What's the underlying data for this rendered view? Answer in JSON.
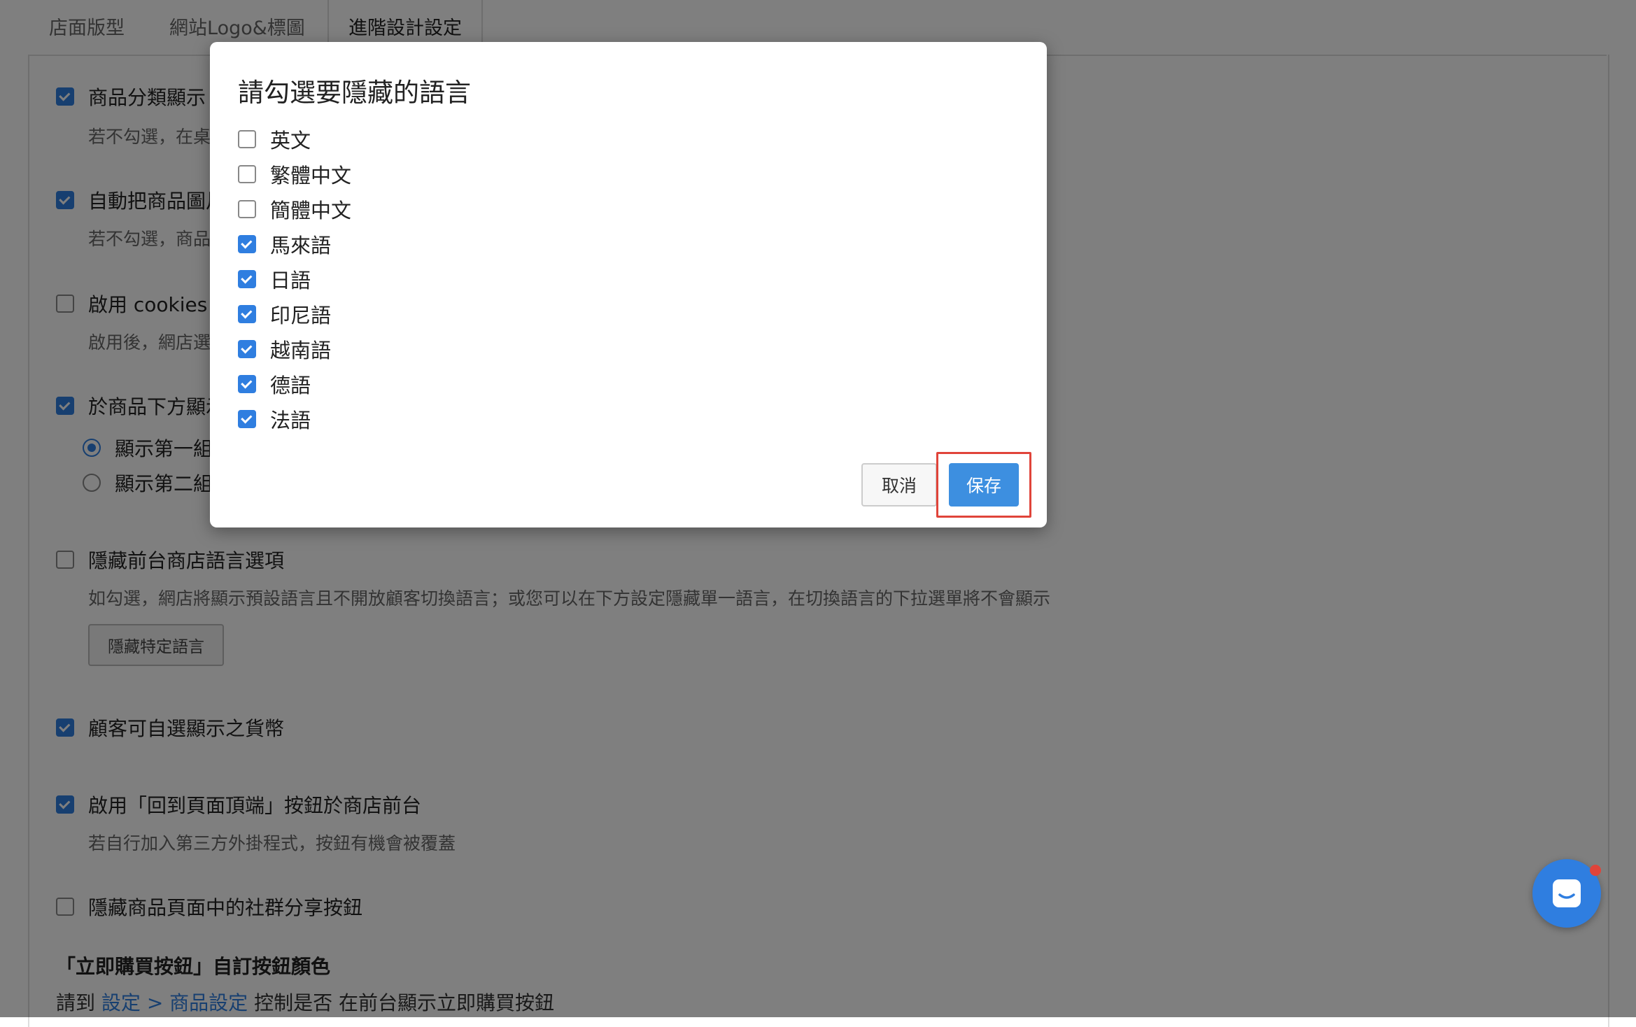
{
  "tabs": [
    "店面版型",
    "網站Logo&標圖",
    "進階設計設定"
  ],
  "settings": {
    "category_display": "商品分類顯示",
    "category_display_desc": "若不勾選，在桌",
    "auto_image": "自動把商品圖片",
    "auto_image_desc": "若不勾選，商品",
    "cookies": "啟用 cookies 提",
    "cookies_desc": "啟用後，網店選",
    "below_product": "於商品下方顯示",
    "radio_1": "顯示第一組",
    "radio_2": "顯示第二組",
    "hide_lang": "隱藏前台商店語言選項",
    "hide_lang_desc": "如勾選，網店將顯示預設語言且不開放顧客切換語言；或您可以在下方設定隱藏單一語言，在切換語言的下拉選單將不會顯示",
    "hide_specific_lang_button": "隱藏特定語言",
    "currency": "顧客可自選顯示之貨幣",
    "back_to_top": "啟用「回到頁面頂端」按鈕於商店前台",
    "back_to_top_desc": "若自行加入第三方外掛程式，按鈕有機會被覆蓋",
    "hide_share": "隱藏商品頁面中的社群分享按鈕",
    "buy_now_heading": "「立即購買按鈕」自訂按鈕顏色",
    "note_prefix": "請到",
    "note_link": "設定 > 商品設定",
    "note_suffix": "控制是否 在前台顯示立即購買按鈕"
  },
  "modal": {
    "title": "請勾選要隱藏的語言",
    "languages": [
      {
        "label": "英文",
        "checked": false
      },
      {
        "label": "繁體中文",
        "checked": false
      },
      {
        "label": "簡體中文",
        "checked": false
      },
      {
        "label": "馬來語",
        "checked": true
      },
      {
        "label": "日語",
        "checked": true
      },
      {
        "label": "印尼語",
        "checked": true
      },
      {
        "label": "越南語",
        "checked": true
      },
      {
        "label": "德語",
        "checked": true
      },
      {
        "label": "法語",
        "checked": true
      }
    ],
    "cancel": "取消",
    "save": "保存"
  },
  "colors": {
    "accent": "#2f7ee0",
    "highlight": "#e0443a"
  }
}
